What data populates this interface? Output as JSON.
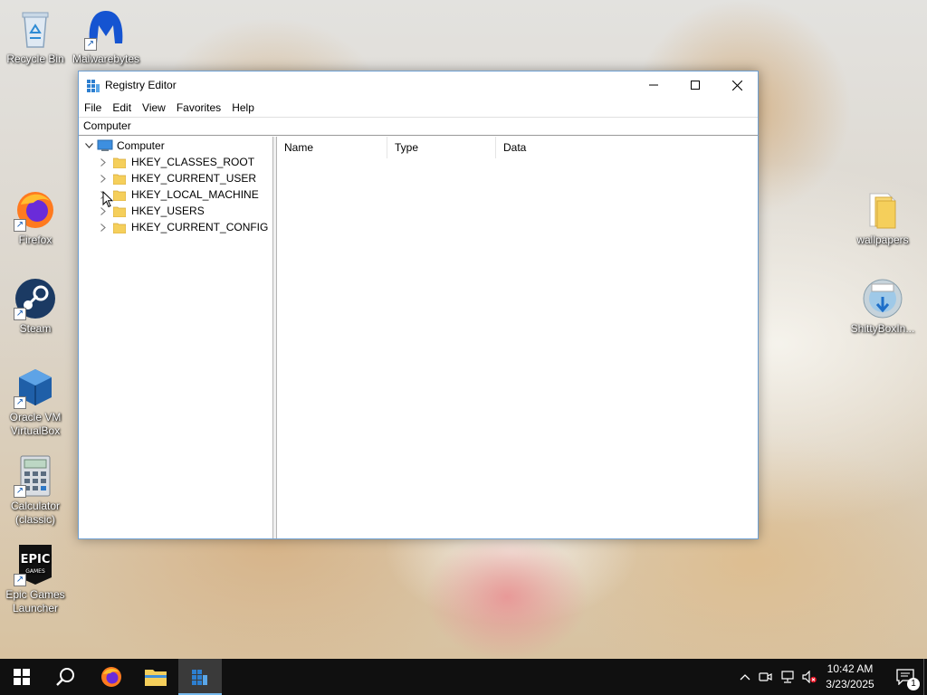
{
  "desktop": {
    "icons_left": [
      {
        "label": "Recycle Bin",
        "icon": "recycle-bin-icon"
      },
      {
        "label": "Malwarebytes",
        "icon": "malwarebytes-icon"
      },
      {
        "label": "Firefox",
        "icon": "firefox-icon"
      },
      {
        "label": "Steam",
        "icon": "steam-icon"
      },
      {
        "label": "Oracle VM VirtualBox",
        "icon": "virtualbox-icon"
      },
      {
        "label": "Calculator (classic)",
        "icon": "calculator-icon"
      },
      {
        "label": "Epic Games Launcher",
        "icon": "epic-games-icon"
      }
    ],
    "icons_right": [
      {
        "label": "wallpapers",
        "icon": "folder-icon"
      },
      {
        "label": "ShittyBoxIn...",
        "icon": "installer-icon"
      }
    ]
  },
  "window": {
    "title": "Registry Editor",
    "icon": "regedit-icon",
    "menu": [
      "File",
      "Edit",
      "View",
      "Favorites",
      "Help"
    ],
    "address": "Computer",
    "tree": {
      "root": "Computer",
      "children": [
        "HKEY_CLASSES_ROOT",
        "HKEY_CURRENT_USER",
        "HKEY_LOCAL_MACHINE",
        "HKEY_USERS",
        "HKEY_CURRENT_CONFIG"
      ]
    },
    "columns": [
      "Name",
      "Type",
      "Data"
    ]
  },
  "taskbar": {
    "pinned": [
      "start-icon",
      "search-icon",
      "firefox-icon",
      "file-explorer-icon",
      "regedit-icon"
    ],
    "active": "regedit-icon",
    "tray": [
      "chevron-up-icon",
      "meet-now-icon",
      "network-icon",
      "volume-muted-icon"
    ],
    "time": "10:42 AM",
    "date": "3/23/2025",
    "notification_count": "1"
  },
  "colors": {
    "taskbar": "#101010",
    "accent": "#76b9ed",
    "folder": "#f5cf5b"
  }
}
